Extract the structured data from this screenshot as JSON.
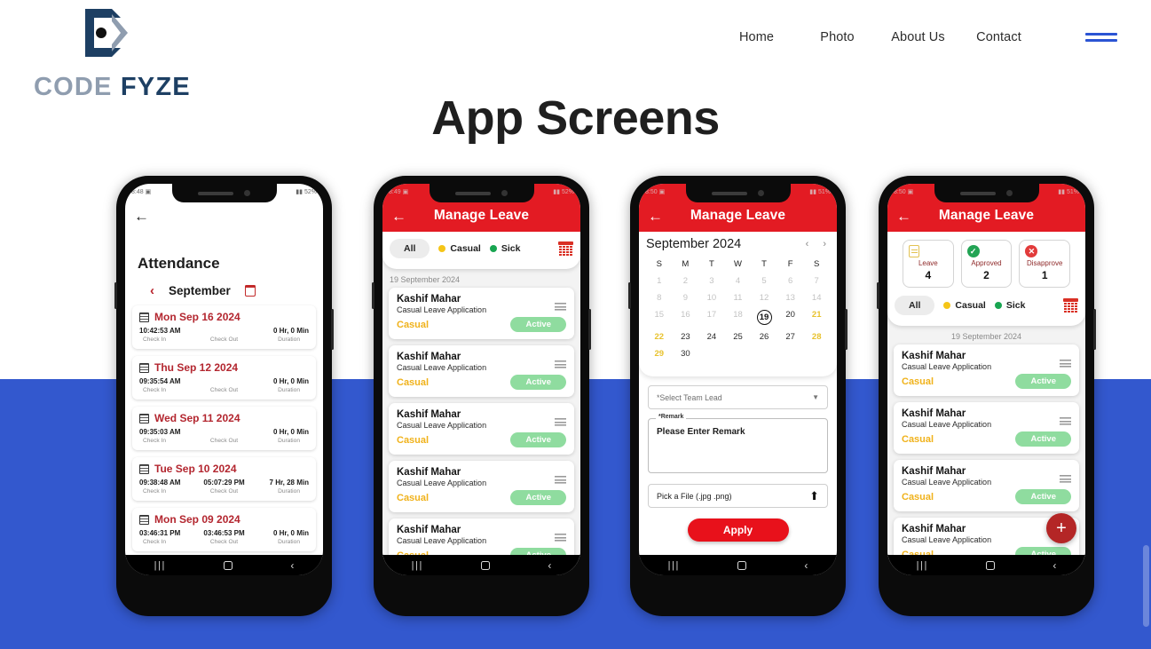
{
  "site": {
    "brand": {
      "part1": "CODE",
      "part2": "FYZE",
      "logo_icon": "codefyze-logo-icon"
    },
    "nav": [
      {
        "label": "Home"
      },
      {
        "label": "Photo"
      },
      {
        "label": "About Us"
      },
      {
        "label": "Contact"
      }
    ],
    "menu_icon": "hamburger-menu-icon",
    "section_title": "App Screens",
    "colors": {
      "accent_blue": "#3358ce",
      "brand_dark": "#1d3f63",
      "brand_grey": "#8f9daf",
      "app_red": "#e31b23"
    }
  },
  "phone1": {
    "status": {
      "time": "8:48",
      "right": "52%"
    },
    "back_icon": "back-arrow-icon",
    "title": "Attendance",
    "month_prev_icon": "chevron-left-icon",
    "month": "September",
    "calendar_icon": "calendar-icon",
    "col_labels": {
      "checkin": "Check In",
      "checkout": "Check Out",
      "duration": "Duration"
    },
    "records": [
      {
        "date": "Mon Sep 16 2024",
        "checkin": "10:42:53 AM",
        "checkout": "",
        "duration": "0 Hr, 0 Min"
      },
      {
        "date": "Thu Sep 12 2024",
        "checkin": "09:35:54 AM",
        "checkout": "",
        "duration": "0 Hr, 0 Min"
      },
      {
        "date": "Wed Sep 11 2024",
        "checkin": "09:35:03 AM",
        "checkout": "",
        "duration": "0 Hr, 0 Min"
      },
      {
        "date": "Tue Sep 10 2024",
        "checkin": "09:38:48 AM",
        "checkout": "05:07:29 PM",
        "duration": "7 Hr, 28 Min"
      },
      {
        "date": "Mon Sep 09 2024",
        "checkin": "03:46:31 PM",
        "checkout": "03:46:53 PM",
        "duration": "0 Hr, 0 Min"
      }
    ],
    "navbtn": {
      "recent": "|||",
      "back": "‹"
    }
  },
  "phone2": {
    "status": {
      "time": "8:49",
      "right": "52%"
    },
    "back_icon": "back-arrow-icon",
    "title": "Manage Leave",
    "filters": {
      "all": "All",
      "casual": "Casual",
      "sick": "Sick",
      "calendar_icon": "calendar-icon"
    },
    "date_header": "19 September 2024",
    "cards": [
      {
        "name": "Kashif Mahar",
        "sub": "Casual Leave Application",
        "type": "Casual",
        "status": "Active"
      },
      {
        "name": "Kashif Mahar",
        "sub": "Casual Leave Application",
        "type": "Casual",
        "status": "Active"
      },
      {
        "name": "Kashif Mahar",
        "sub": "Casual Leave Application",
        "type": "Casual",
        "status": "Active"
      },
      {
        "name": "Kashif Mahar",
        "sub": "Casual Leave Application",
        "type": "Casual",
        "status": "Active"
      },
      {
        "name": "Kashif Mahar",
        "sub": "Casual Leave Application",
        "type": "Casual",
        "status": "Active"
      }
    ],
    "navbtn": {
      "recent": "|||",
      "back": "‹"
    }
  },
  "phone3": {
    "status": {
      "time": "8:50",
      "right": "51%"
    },
    "back_icon": "back-arrow-icon",
    "title": "Manage Leave",
    "calendar": {
      "month_label": "September 2024",
      "prev_icon": "chevron-left-icon",
      "next_icon": "chevron-right-icon",
      "dow": [
        "S",
        "M",
        "T",
        "W",
        "T",
        "F",
        "S"
      ],
      "days": [
        {
          "d": "1",
          "state": "past"
        },
        {
          "d": "2",
          "state": "past"
        },
        {
          "d": "3",
          "state": "past"
        },
        {
          "d": "4",
          "state": "past"
        },
        {
          "d": "5",
          "state": "past"
        },
        {
          "d": "6",
          "state": "past"
        },
        {
          "d": "7",
          "state": "past"
        },
        {
          "d": "8",
          "state": "past"
        },
        {
          "d": "9",
          "state": "past"
        },
        {
          "d": "10",
          "state": "past"
        },
        {
          "d": "11",
          "state": "past"
        },
        {
          "d": "12",
          "state": "past"
        },
        {
          "d": "13",
          "state": "past"
        },
        {
          "d": "14",
          "state": "past"
        },
        {
          "d": "15",
          "state": "past"
        },
        {
          "d": "16",
          "state": "past"
        },
        {
          "d": "17",
          "state": "past"
        },
        {
          "d": "18",
          "state": "past"
        },
        {
          "d": "19",
          "state": "today"
        },
        {
          "d": "20",
          "state": "normal"
        },
        {
          "d": "21",
          "state": "wknd"
        },
        {
          "d": "22",
          "state": "wknd"
        },
        {
          "d": "23",
          "state": "normal"
        },
        {
          "d": "24",
          "state": "normal"
        },
        {
          "d": "25",
          "state": "normal"
        },
        {
          "d": "26",
          "state": "normal"
        },
        {
          "d": "27",
          "state": "normal"
        },
        {
          "d": "28",
          "state": "wknd"
        },
        {
          "d": "29",
          "state": "wknd"
        },
        {
          "d": "30",
          "state": "normal"
        }
      ]
    },
    "form": {
      "team_lead_placeholder": "*Select Team Lead",
      "dropdown_icon": "chevron-down-icon",
      "remark_label": "*Remark",
      "remark_placeholder": "Please Enter Remark",
      "file_placeholder": "Pick a File (.jpg .png)",
      "upload_icon": "upload-icon",
      "apply_label": "Apply"
    },
    "navbtn": {
      "recent": "|||",
      "back": "‹"
    }
  },
  "phone4": {
    "status": {
      "time": "8:50",
      "right": "51%"
    },
    "back_icon": "back-arrow-icon",
    "title": "Manage Leave",
    "stats": [
      {
        "icon": "document-icon",
        "label": "Leave",
        "value": "4"
      },
      {
        "icon": "check-circle-icon",
        "label": "Approved",
        "value": "2"
      },
      {
        "icon": "close-circle-icon",
        "label": "Disapprove",
        "value": "1"
      }
    ],
    "filters": {
      "all": "All",
      "casual": "Casual",
      "sick": "Sick",
      "calendar_icon": "calendar-icon"
    },
    "date_header": "19 September 2024",
    "cards": [
      {
        "name": "Kashif Mahar",
        "sub": "Casual Leave Application",
        "type": "Casual",
        "status": "Active"
      },
      {
        "name": "Kashif Mahar",
        "sub": "Casual Leave Application",
        "type": "Casual",
        "status": "Active"
      },
      {
        "name": "Kashif Mahar",
        "sub": "Casual Leave Application",
        "type": "Casual",
        "status": "Active"
      },
      {
        "name": "Kashif Mahar",
        "sub": "Casual Leave Application",
        "type": "Casual",
        "status": "Active"
      }
    ],
    "fab_icon": "add-icon",
    "navbtn": {
      "recent": "|||",
      "back": "‹"
    }
  }
}
